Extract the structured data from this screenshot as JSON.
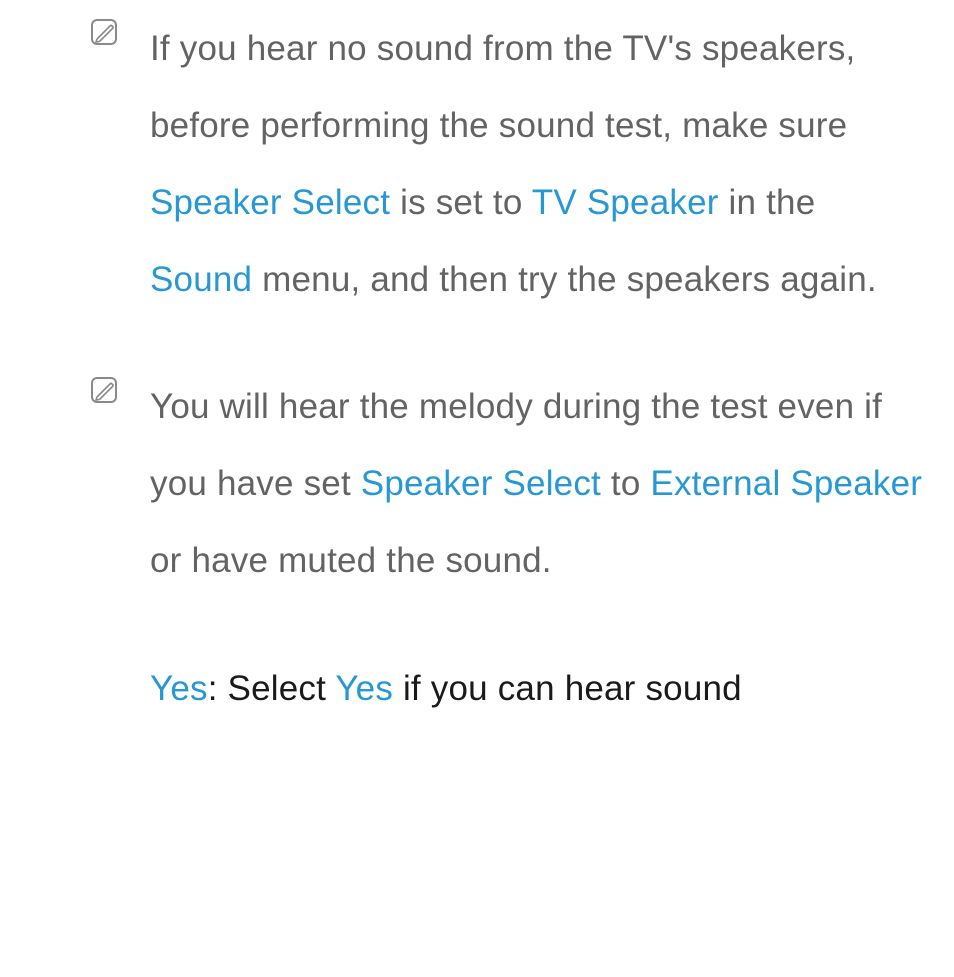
{
  "note1": {
    "t1": "If you hear no sound from the TV's speakers, before performing the sound test, make sure ",
    "t2": "Speaker Select",
    "t3": " is set to ",
    "t4": "TV Speaker",
    "t5": " in the ",
    "t6": "Sound",
    "t7": " menu, and then try the speakers again."
  },
  "note2": {
    "t1": "You will hear the melody during the test even if you have set ",
    "t2": "Speaker Select",
    "t3": " to ",
    "t4": "External Speaker",
    "t5": " or have muted the sound."
  },
  "bottom": {
    "t1": "Yes",
    "t2": ": Select ",
    "t3": "Yes",
    "t4": " if you can hear sound"
  }
}
